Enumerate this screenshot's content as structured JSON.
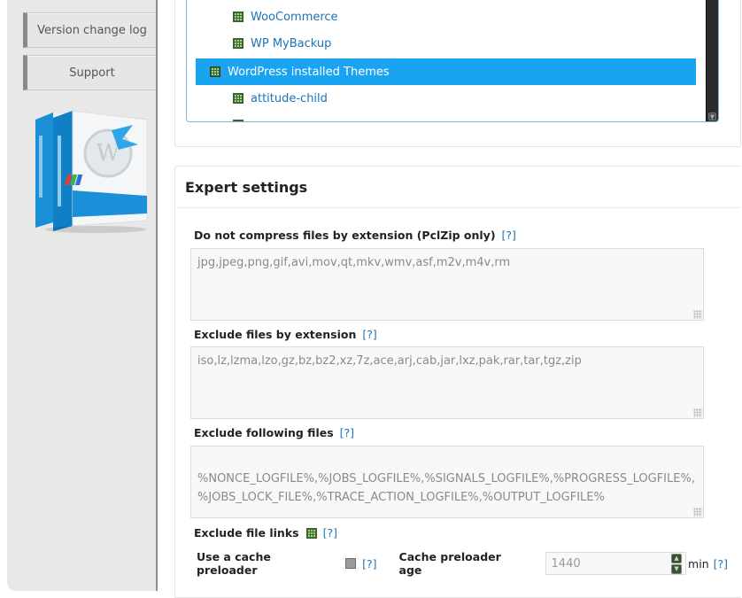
{
  "sidebar": {
    "buttons": [
      {
        "label": "Version change log"
      },
      {
        "label": "Support"
      }
    ],
    "product_box_label": "mynixworld.info WordPress plugin"
  },
  "tree": {
    "items": [
      {
        "label": "WooCommerce",
        "level": 2,
        "selected": false
      },
      {
        "label": "WP MyBackup",
        "level": 2,
        "selected": false
      },
      {
        "label": "WordPress installed Themes",
        "level": 1,
        "selected": true
      },
      {
        "label": "attitude-child",
        "level": 2,
        "selected": false
      }
    ]
  },
  "expert": {
    "title": "Expert settings",
    "help_label": "[?]",
    "no_compress": {
      "label": "Do not compress files by extension (PclZip only)",
      "value": "jpg,jpeg,png,gif,avi,mov,qt,mkv,wmv,asf,m2v,m4v,rm"
    },
    "exclude_ext": {
      "label": "Exclude files by extension",
      "value": "iso,lz,lzma,lzo,gz,bz,bz2,xz,7z,ace,arj,cab,jar,lxz,pak,rar,tar,tgz,zip"
    },
    "exclude_files": {
      "label": "Exclude following files",
      "value": "%NONCE_LOGFILE%,%JOBS_LOGFILE%,%SIGNALS_LOGFILE%,%PROGRESS_LOGFILE%,\n%JOBS_LOCK_FILE%,%TRACE_ACTION_LOGFILE%,%OUTPUT_LOGFILE%"
    },
    "exclude_links": {
      "label": "Exclude file links",
      "checked": true
    },
    "cache_preloader": {
      "label": "Use a cache preloader",
      "checked": false
    },
    "cache_age": {
      "label": "Cache preloader age",
      "value": "1440",
      "unit": "min"
    }
  },
  "colors": {
    "selection": "#1aa3f0",
    "link": "#1b73b8",
    "sidebar_bg": "#e8e8e8"
  }
}
